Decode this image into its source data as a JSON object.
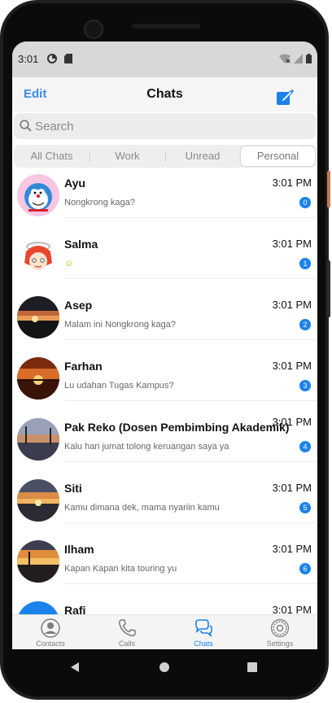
{
  "statusbar": {
    "time": "3:01"
  },
  "header": {
    "edit_label": "Edit",
    "title": "Chats"
  },
  "search": {
    "placeholder": "Search"
  },
  "segments": [
    "All Chats",
    "Work",
    "Unread",
    "Personal"
  ],
  "selected_segment": "Personal",
  "chats": [
    {
      "name": "Ayu",
      "time": "3:01 PM",
      "preview": "Nongkrong kaga?",
      "badge": "0"
    },
    {
      "name": "Salma",
      "time": "3:01 PM",
      "preview": "☺",
      "badge": "1"
    },
    {
      "name": "Asep",
      "time": "3:01 PM",
      "preview": "Malam ini Nongkrong kaga?",
      "badge": "2"
    },
    {
      "name": "Farhan",
      "time": "3:01 PM",
      "preview": "Lu udahan Tugas Kampus?",
      "badge": "3"
    },
    {
      "name": "Pak Reko (Dosen Pembimbing Akademik)",
      "time": "3:01 PM",
      "preview": "Kalu hari jumat tolong keruangan saya ya",
      "badge": "4"
    },
    {
      "name": "Siti",
      "time": "3:01 PM",
      "preview": "Kamu dimana dek, mama nyariin kamu",
      "badge": "5"
    },
    {
      "name": "Ilham",
      "time": "3:01 PM",
      "preview": "Kapan Kapan kita touring yu",
      "badge": "6"
    },
    {
      "name": "Rafi",
      "time": "3:01 PM",
      "preview": "",
      "badge": ""
    }
  ],
  "tabs": [
    {
      "label": "Contacts",
      "icon": "person-icon"
    },
    {
      "label": "Calls",
      "icon": "phone-icon"
    },
    {
      "label": "Chats",
      "icon": "chat-bubbles-icon"
    },
    {
      "label": "Settings",
      "icon": "gear-icon"
    }
  ],
  "active_tab": "Chats",
  "colors": {
    "accent": "#1a82ea",
    "link": "#3a8ee6",
    "statusbar": "#d8d8d8"
  }
}
